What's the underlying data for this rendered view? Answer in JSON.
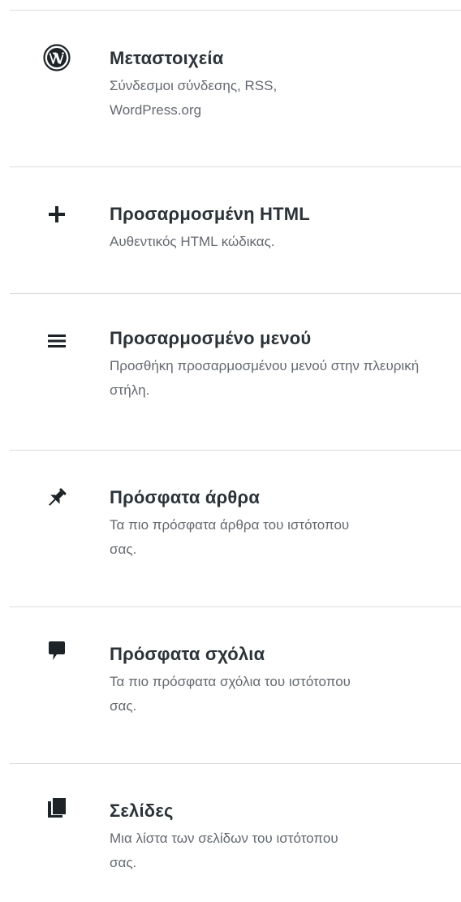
{
  "widgets": [
    {
      "icon": "wordpress-icon",
      "title": "Μεταστοιχεία",
      "description": "Σύνδεσμοι σύνδεσης, RSS, WordPress.org"
    },
    {
      "icon": "plus-icon",
      "title": "Προσαρμοσμένη HTML",
      "description": "Αυθεντικός HTML κώδικας."
    },
    {
      "icon": "menu-icon",
      "title": "Προσαρμοσμένο μενού",
      "description": "Προσθήκη προσαρμοσμένου μενού στην πλευρική στήλη."
    },
    {
      "icon": "pin-icon",
      "title": "Πρόσφατα άρθρα",
      "description": "Τα πιο πρόσφατα άρθρα του ιστότοπου σας."
    },
    {
      "icon": "comment-icon",
      "title": "Πρόσφατα σχόλια",
      "description": "Τα πιο πρόσφατα σχόλια του ιστότοπου σας."
    },
    {
      "icon": "pages-icon",
      "title": "Σελίδες",
      "description": "Μια λίστα των σελίδων του ιστότοπου σας."
    }
  ],
  "colors": {
    "title": "#2c3338",
    "description": "#646970",
    "divider": "#dcdcde",
    "icon": "#1d2327"
  }
}
